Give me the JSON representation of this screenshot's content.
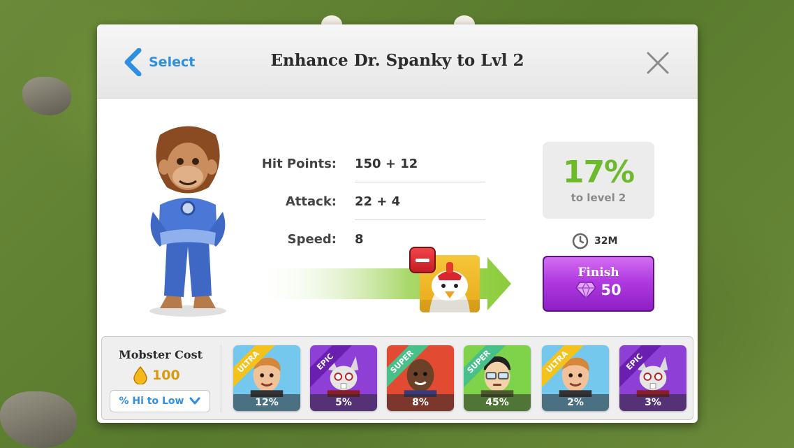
{
  "header": {
    "back_label": "Select",
    "title": "Enhance Dr. Spanky to Lvl 2"
  },
  "stats": [
    {
      "label": "Hit Points:",
      "value": "150 + 12"
    },
    {
      "label": "Attack:",
      "value": "22 + 4"
    },
    {
      "label": "Speed:",
      "value": "8"
    }
  ],
  "progress": {
    "percent": "17%",
    "subtitle": "to level 2"
  },
  "timer": {
    "label": "32M"
  },
  "finish": {
    "label": "Finish",
    "cost": "50"
  },
  "cost": {
    "title": "Mobster Cost",
    "value": "100"
  },
  "sort": {
    "label": "% Hi to Low"
  },
  "cards": [
    {
      "rarity": "ULTRA",
      "percent": "12%",
      "bg": "#74c8ee",
      "ribbon": "#f4c21c",
      "face": "human"
    },
    {
      "rarity": "EPIC",
      "percent": "5%",
      "bg": "#8d3fd6",
      "ribbon": "#6a1fb0",
      "face": "rabbit"
    },
    {
      "rarity": "SUPER",
      "percent": "8%",
      "bg": "#e24a32",
      "ribbon": "#48c08a",
      "face": "bald"
    },
    {
      "rarity": "SUPER",
      "percent": "45%",
      "bg": "#7fd34a",
      "ribbon": "#48c08a",
      "face": "glasses"
    },
    {
      "rarity": "ULTRA",
      "percent": "2%",
      "bg": "#74c8ee",
      "ribbon": "#f4c21c",
      "face": "human"
    },
    {
      "rarity": "EPIC",
      "percent": "3%",
      "bg": "#8d3fd6",
      "ribbon": "#6a1fb0",
      "face": "rabbit"
    }
  ]
}
